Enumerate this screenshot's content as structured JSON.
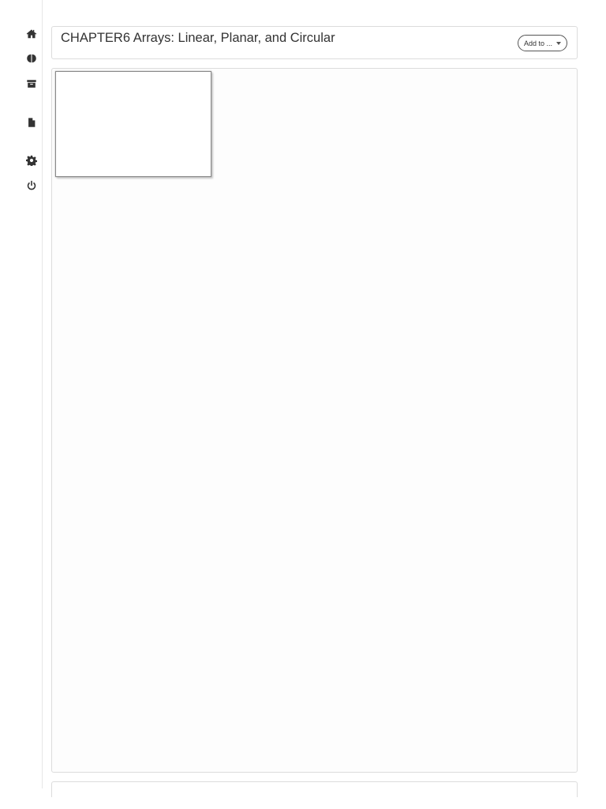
{
  "header": {
    "title": "CHAPTER6 Arrays: Linear, Planar, and Circular",
    "add_to_label": "Add to ..."
  },
  "sidebar": {
    "items": [
      {
        "icon": "home-icon"
      },
      {
        "icon": "brain-icon"
      },
      {
        "icon": "archive-icon"
      },
      {
        "icon": "file-icon"
      },
      {
        "icon": "gear-icon"
      },
      {
        "icon": "power-icon"
      }
    ]
  },
  "colors": {
    "text": "#333333",
    "border": "#dcdcdc",
    "icon": "#333333"
  }
}
